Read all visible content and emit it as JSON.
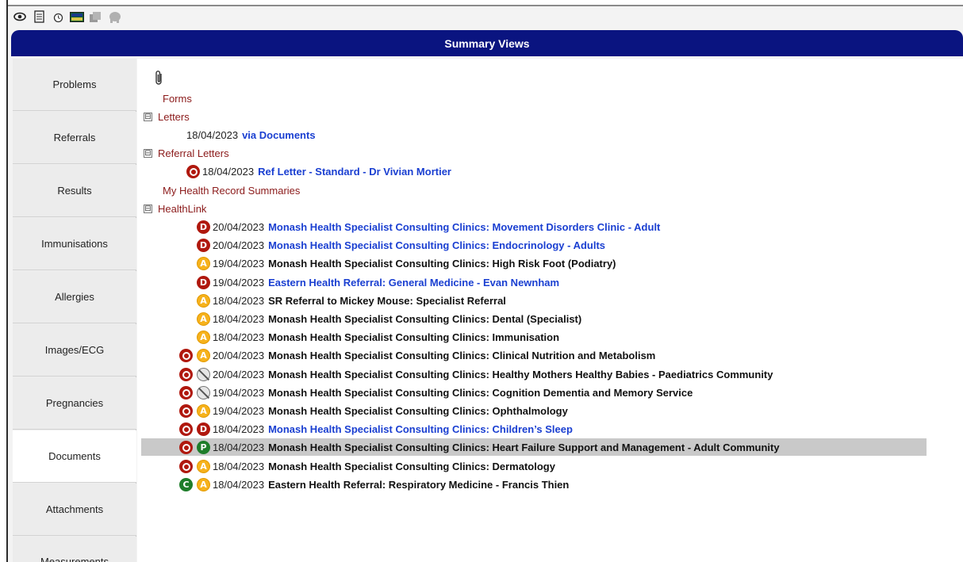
{
  "window": {
    "title": "Summary Views",
    "toolbar_icons": [
      "eye-icon",
      "document-icon",
      "alarm-clock-icon",
      "image-icon",
      "gallery-icon",
      "elephant-icon"
    ]
  },
  "sidebar": {
    "items": [
      {
        "label": "Problems"
      },
      {
        "label": "Referrals"
      },
      {
        "label": "Results"
      },
      {
        "label": "Immunisations"
      },
      {
        "label": "Allergies"
      },
      {
        "label": "Images/ECG"
      },
      {
        "label": "Pregnancies"
      },
      {
        "label": "Documents",
        "active": true
      },
      {
        "label": "Attachments"
      },
      {
        "label": "Measurements"
      }
    ]
  },
  "tree": {
    "groups": {
      "forms": "Forms",
      "letters": "Letters",
      "referral_letters": "Referral Letters",
      "mhr": "My Health Record Summaries",
      "healthlink": "HealthLink"
    },
    "toggle_symbol": "⊟",
    "letters_items": [
      {
        "date": "18/04/2023",
        "text": "via Documents",
        "link": true
      }
    ],
    "referral_items": [
      {
        "date": "18/04/2023",
        "text": "Ref Letter - Standard - Dr Vivian Mortier",
        "link": true
      }
    ],
    "healthlink_items": [
      {
        "date": "20/04/2023",
        "text": "Monash Health Specialist Consulting Clinics: Movement Disorders Clinic - Adult",
        "link": true,
        "icons": [
          "",
          "D"
        ]
      },
      {
        "date": "20/04/2023",
        "text": "Monash Health Specialist Consulting Clinics: Endocrinology - Adults",
        "link": true,
        "icons": [
          "",
          "D"
        ]
      },
      {
        "date": "19/04/2023",
        "text": "Monash Health Specialist Consulting Clinics: High Risk Foot (Podiatry)",
        "link": false,
        "icons": [
          "",
          "A"
        ]
      },
      {
        "date": "19/04/2023",
        "text": "Eastern Health Referral: General Medicine - Evan Newnham",
        "link": true,
        "icons": [
          "",
          "D"
        ]
      },
      {
        "date": "18/04/2023",
        "text": "SR Referral to Mickey Mouse: Specialist Referral",
        "link": false,
        "icons": [
          "",
          "A"
        ]
      },
      {
        "date": "18/04/2023",
        "text": "Monash Health Specialist Consulting Clinics: Dental (Specialist)",
        "link": false,
        "icons": [
          "",
          "A"
        ]
      },
      {
        "date": "18/04/2023",
        "text": "Monash Health Specialist Consulting Clinics: Immunisation",
        "link": false,
        "icons": [
          "",
          "A"
        ]
      },
      {
        "date": "20/04/2023",
        "text": "Monash Health Specialist Consulting Clinics: Clinical Nutrition and Metabolism",
        "link": false,
        "icons": [
          "target",
          "A"
        ]
      },
      {
        "date": "20/04/2023",
        "text": "Monash Health Specialist Consulting Clinics: Healthy Mothers Healthy Babies - Paediatrics Community",
        "link": false,
        "icons": [
          "target",
          "no"
        ]
      },
      {
        "date": "19/04/2023",
        "text": "Monash Health Specialist Consulting Clinics: Cognition Dementia and Memory Service",
        "link": false,
        "icons": [
          "target",
          "no"
        ]
      },
      {
        "date": "19/04/2023",
        "text": "Monash Health Specialist Consulting Clinics: Ophthalmology",
        "link": false,
        "icons": [
          "target",
          "A"
        ]
      },
      {
        "date": "18/04/2023",
        "text": "Monash Health Specialist Consulting Clinics: Children’s Sleep",
        "link": true,
        "icons": [
          "target",
          "D"
        ]
      },
      {
        "date": "18/04/2023",
        "text": "Monash Health Specialist Consulting Clinics: Heart Failure Support and Management - Adult Community",
        "link": false,
        "icons": [
          "target",
          "P"
        ],
        "selected": true
      },
      {
        "date": "18/04/2023",
        "text": "Monash Health Specialist Consulting Clinics: Dermatology",
        "link": false,
        "icons": [
          "target",
          "A"
        ]
      },
      {
        "date": "18/04/2023",
        "text": "Eastern Health Referral: Respiratory Medicine - Francis Thien",
        "link": false,
        "icons": [
          "C",
          "A"
        ]
      }
    ]
  }
}
